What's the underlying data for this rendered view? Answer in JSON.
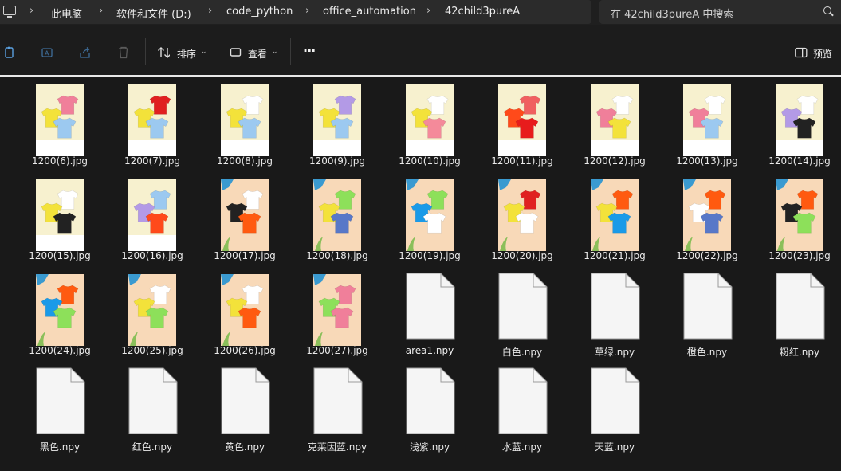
{
  "breadcrumb": {
    "items": [
      "此电脑",
      "软件和文件 (D:)",
      "code_python",
      "office_automation",
      "42child3pureA"
    ]
  },
  "search": {
    "placeholder": "在 42child3pureA 中搜索"
  },
  "toolbar": {
    "sort_label": "排序",
    "view_label": "查看",
    "more_label": "···",
    "preview_label": "预览"
  },
  "icons": {
    "pc": "computer-icon",
    "search": "search-icon",
    "copy": "copy-icon",
    "rename": "rename-icon",
    "share": "share-icon",
    "delete": "delete-icon",
    "sort": "sort-icon",
    "view": "view-icon",
    "preview": "preview-pane-icon"
  },
  "files": [
    {
      "name": "1200(6).jpg",
      "type": "image",
      "bg": "cream",
      "shirts": [
        "#f07f9a",
        "#f3e23a",
        "#9cc9f0"
      ]
    },
    {
      "name": "1200(7).jpg",
      "type": "image",
      "bg": "cream",
      "shirts": [
        "#e02020",
        "#f3e23a",
        "#9cc9f0"
      ]
    },
    {
      "name": "1200(8).jpg",
      "type": "image",
      "bg": "cream",
      "shirts": [
        "#ffffff",
        "#f3e23a",
        "#9cc9f0"
      ]
    },
    {
      "name": "1200(9).jpg",
      "type": "image",
      "bg": "cream",
      "shirts": [
        "#b39ae6",
        "#f3e23a",
        "#9cc9f0"
      ]
    },
    {
      "name": "1200(10).jpg",
      "type": "image",
      "bg": "cream",
      "shirts": [
        "#ffffff",
        "#f3e23a",
        "#f48a9a"
      ]
    },
    {
      "name": "1200(11).jpg",
      "type": "image",
      "bg": "cream",
      "shirts": [
        "#f06060",
        "#ff4a1a",
        "#e81c1c"
      ]
    },
    {
      "name": "1200(12).jpg",
      "type": "image",
      "bg": "cream",
      "shirts": [
        "#ffffff",
        "#f07f9a",
        "#f3e23a"
      ]
    },
    {
      "name": "1200(13).jpg",
      "type": "image",
      "bg": "cream",
      "shirts": [
        "#ffffff",
        "#f07f9a",
        "#9cc9f0"
      ]
    },
    {
      "name": "1200(14).jpg",
      "type": "image",
      "bg": "cream",
      "shirts": [
        "#ffffff",
        "#b39ae6",
        "#222222"
      ]
    },
    {
      "name": "1200(15).jpg",
      "type": "image",
      "bg": "cream",
      "shirts": [
        "#ffffff",
        "#f3e23a",
        "#222222"
      ]
    },
    {
      "name": "1200(16).jpg",
      "type": "image",
      "bg": "cream",
      "shirts": [
        "#9cc9f0",
        "#b39ae6",
        "#ff4a1a"
      ]
    },
    {
      "name": "1200(17).jpg",
      "type": "image",
      "bg": "peach",
      "shirts": [
        "#ffffff",
        "#222222",
        "#ff5a10"
      ]
    },
    {
      "name": "1200(18).jpg",
      "type": "image",
      "bg": "peach",
      "shirts": [
        "#8de05a",
        "#f3e23a",
        "#5878c8"
      ]
    },
    {
      "name": "1200(19).jpg",
      "type": "image",
      "bg": "peach",
      "shirts": [
        "#8de05a",
        "#1a9ae8",
        "#ffffff"
      ]
    },
    {
      "name": "1200(20).jpg",
      "type": "image",
      "bg": "peach",
      "shirts": [
        "#e02020",
        "#f3e23a",
        "#ffffff"
      ]
    },
    {
      "name": "1200(21).jpg",
      "type": "image",
      "bg": "peach",
      "shirts": [
        "#ff5a10",
        "#f3e23a",
        "#1a9ae8"
      ]
    },
    {
      "name": "1200(22).jpg",
      "type": "image",
      "bg": "peach",
      "shirts": [
        "#ff5a10",
        "#ffffff",
        "#5878c8"
      ]
    },
    {
      "name": "1200(23).jpg",
      "type": "image",
      "bg": "peach",
      "shirts": [
        "#ff5a10",
        "#222222",
        "#8de05a"
      ]
    },
    {
      "name": "1200(24).jpg",
      "type": "image",
      "bg": "peach",
      "shirts": [
        "#ff5a10",
        "#1a9ae8",
        "#8de05a"
      ]
    },
    {
      "name": "1200(25).jpg",
      "type": "image",
      "bg": "peach",
      "shirts": [
        "#ffffff",
        "#f3e23a",
        "#8de05a"
      ]
    },
    {
      "name": "1200(26).jpg",
      "type": "image",
      "bg": "peach",
      "shirts": [
        "#ffffff",
        "#f3e23a",
        "#ff5a10"
      ]
    },
    {
      "name": "1200(27).jpg",
      "type": "image",
      "bg": "peach",
      "shirts": [
        "#f07f9a",
        "#8de05a",
        "#f07f9a"
      ]
    },
    {
      "name": "area1.npy",
      "type": "doc"
    },
    {
      "name": "白色.npy",
      "type": "doc"
    },
    {
      "name": "草绿.npy",
      "type": "doc"
    },
    {
      "name": "橙色.npy",
      "type": "doc"
    },
    {
      "name": "粉红.npy",
      "type": "doc"
    },
    {
      "name": "黑色.npy",
      "type": "doc"
    },
    {
      "name": "红色.npy",
      "type": "doc"
    },
    {
      "name": "黄色.npy",
      "type": "doc"
    },
    {
      "name": "克莱因蓝.npy",
      "type": "doc"
    },
    {
      "name": "浅紫.npy",
      "type": "doc"
    },
    {
      "name": "水蓝.npy",
      "type": "doc"
    },
    {
      "name": "天蓝.npy",
      "type": "doc"
    }
  ],
  "colors": {
    "cream_bg": "#f7f1cf",
    "peach_bg": "#f8d9b8",
    "accent": "#e8e8e8"
  }
}
